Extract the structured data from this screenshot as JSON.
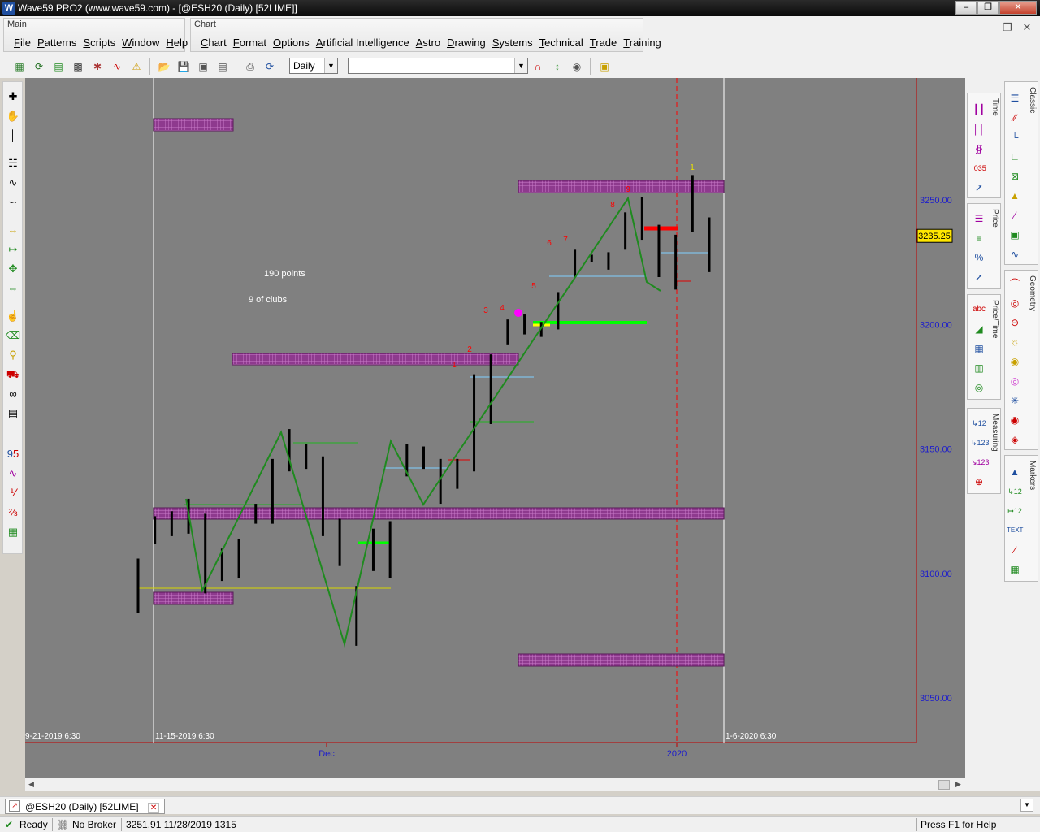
{
  "window": {
    "title": "Wave59 PRO2 (www.wave59.com) - [@ESH20 (Daily) [52LIME]]"
  },
  "menus": {
    "main_group": "Main",
    "main_items": [
      "File",
      "Patterns",
      "Scripts",
      "Window",
      "Help"
    ],
    "chart_group": "Chart",
    "chart_items": [
      "Chart",
      "Format",
      "Options",
      "Artificial Intelligence",
      "Astro",
      "Drawing",
      "Systems",
      "Technical",
      "Trade",
      "Training"
    ]
  },
  "toolbar": {
    "interval_value": "Daily",
    "symbol_value": ""
  },
  "colors": {
    "background": "#808080",
    "bar": "#000000",
    "zigzag": "#1f8a1f",
    "box": "#8e3a8e",
    "axis_text": "#1c1ccc",
    "count_text": "#ff0000",
    "price_badge": "#ffe600"
  },
  "annotations": {
    "points_text": "190 points",
    "card_text": "9 of clubs"
  },
  "chart_data": {
    "type": "bar",
    "symbol": "@ESH20",
    "interval": "Daily",
    "y_ticks": [
      "3250.00",
      "3200.00",
      "3150.00",
      "3100.00",
      "3050.00"
    ],
    "x_ticks": [
      "Dec",
      "2020"
    ],
    "current_price": "3235.25",
    "date_labels": {
      "left_clipped": "9-21-2019 6:30",
      "range_start": "11-15-2019 6:30",
      "range_end": "1-6-2020 6:30"
    },
    "wave_counts": [
      "1",
      "2",
      "3",
      "4",
      "5",
      "6",
      "7",
      "8",
      "9",
      "1"
    ],
    "bars": [
      {
        "h": 3106,
        "l": 3084
      },
      {
        "h": 3123,
        "l": 3112
      },
      {
        "h": 3125,
        "l": 3115
      },
      {
        "h": 3130,
        "l": 3116
      },
      {
        "h": 3124,
        "l": 3092
      },
      {
        "h": 3110,
        "l": 3097
      },
      {
        "h": 3114,
        "l": 3098
      },
      {
        "h": 3128,
        "l": 3120
      },
      {
        "h": 3146,
        "l": 3120
      },
      {
        "h": 3158,
        "l": 3141
      },
      {
        "h": 3152,
        "l": 3142
      },
      {
        "h": 3147,
        "l": 3115
      },
      {
        "h": 3122,
        "l": 3103
      },
      {
        "h": 3095,
        "l": 3071
      },
      {
        "h": 3118,
        "l": 3101
      },
      {
        "h": 3121,
        "l": 3098
      },
      {
        "h": 3152,
        "l": 3139
      },
      {
        "h": 3151,
        "l": 3142
      },
      {
        "h": 3146,
        "l": 3128
      },
      {
        "h": 3146,
        "l": 3134
      },
      {
        "h": 3180,
        "l": 3141
      },
      {
        "h": 3188,
        "l": 3160
      },
      {
        "h": 3202,
        "l": 3192
      },
      {
        "h": 3204,
        "l": 3196
      },
      {
        "h": 3201,
        "l": 3195
      },
      {
        "h": 3213,
        "l": 3198
      },
      {
        "h": 3230,
        "l": 3219
      },
      {
        "h": 3228,
        "l": 3225
      },
      {
        "h": 3229,
        "l": 3222
      },
      {
        "h": 3245,
        "l": 3230
      },
      {
        "h": 3251,
        "l": 3234
      },
      {
        "h": 3240,
        "l": 3219
      },
      {
        "h": 3236,
        "l": 3214
      },
      {
        "h": 3260,
        "l": 3237
      },
      {
        "h": 3243,
        "l": 3221
      }
    ]
  },
  "tabs": {
    "doc_tab": "@ESH20 (Daily) [52LIME]"
  },
  "status": {
    "ready": "Ready",
    "broker": "No Broker",
    "cursor_info": "3251.91  11/28/2019  1315",
    "help": "Press F1 for Help"
  },
  "panels": {
    "time": "Time",
    "price": "Price",
    "price_time": "Price/Time",
    "measuring": "Measuring",
    "classic": "Classic",
    "geometry": "Geometry",
    "markers": "Markers"
  }
}
